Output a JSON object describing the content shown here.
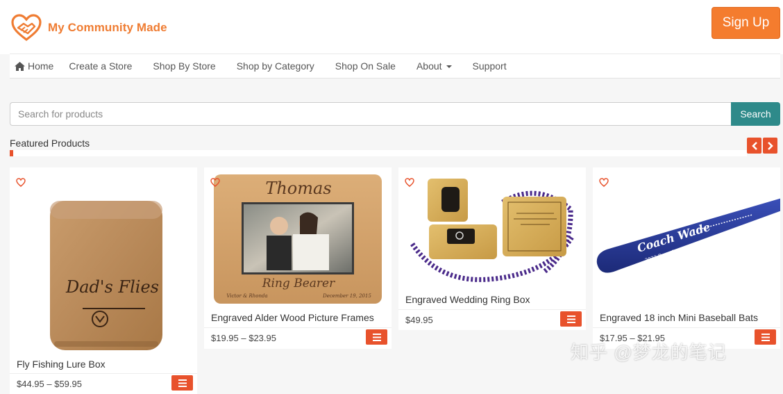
{
  "brand": {
    "name": "My Community Made",
    "color": "#ef7c32"
  },
  "header": {
    "signup_label": "Sign Up"
  },
  "nav": {
    "items": [
      {
        "label": "Home",
        "icon": "home-icon"
      },
      {
        "label": "Create a Store"
      },
      {
        "label": "Shop By Store"
      },
      {
        "label": "Shop by Category"
      },
      {
        "label": "Shop On Sale"
      },
      {
        "label": "About",
        "dropdown": true
      },
      {
        "label": "Support"
      }
    ]
  },
  "search": {
    "placeholder": "Search for products",
    "button_label": "Search"
  },
  "featured": {
    "title": "Featured Products"
  },
  "products": [
    {
      "title": "Fly Fishing Lure Box",
      "price": "$44.95 – $59.95",
      "image": "engraved wooden box with fly rod and text Dad's Flies"
    },
    {
      "title": "Engraved Alder Wood Picture Frames",
      "price": "$19.95 – $23.95",
      "image": "wood picture frame engraved Thomas / Ring Bearer"
    },
    {
      "title": "Engraved Wedding Ring Box",
      "price": "$49.95",
      "image": "wooden ring box with purple bead necklace"
    },
    {
      "title": "Engraved 18 inch Mini Baseball Bats",
      "price": "$17.95 – $21.95",
      "image": "blue mini baseball bat engraved Coach Wade"
    }
  ],
  "frame_text": {
    "name": "Thomas",
    "role": "Ring Bearer",
    "left": "Victor & Rhonda",
    "right": "December 19, 2015"
  },
  "box_text": {
    "line": "Dad's Flies"
  },
  "bat_text": {
    "name": "Coach Wade",
    "sub": "2022 Deep Run Wildcats"
  },
  "watermark": "知乎 @梦龙的笔记",
  "colors": {
    "accent": "#e8522c",
    "signup": "#f47c2e",
    "search": "#2e8a8a"
  }
}
